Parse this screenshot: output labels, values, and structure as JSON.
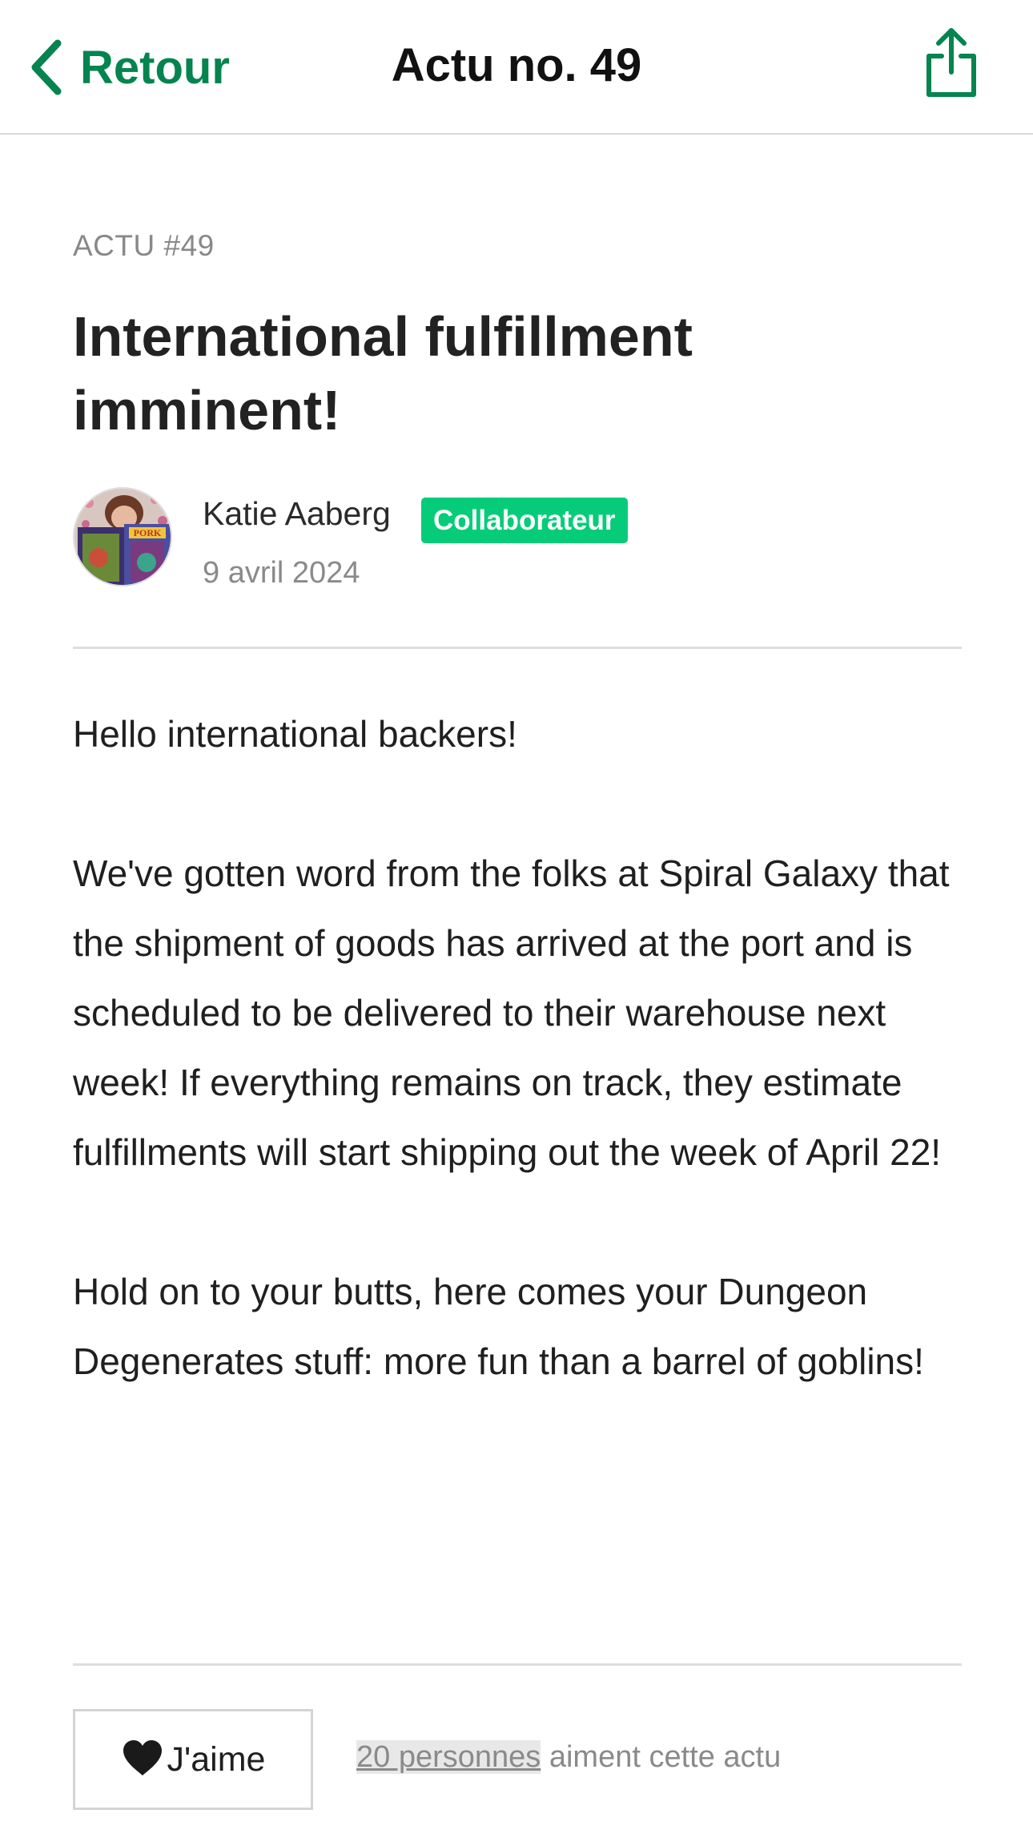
{
  "nav": {
    "back_label": "Retour",
    "title": "Actu no. 49",
    "back_icon": "chevron-left-icon",
    "share_icon": "share-icon"
  },
  "post": {
    "kicker": "ACTU #49",
    "title": "International fulfillment imminent!",
    "author": {
      "name": "Katie Aaberg",
      "role_badge": "Collaborateur",
      "avatar_icon": "avatar"
    },
    "date": "9 avril 2024",
    "paragraphs": [
      "Hello international backers!",
      "We've gotten word from the folks at Spiral Galaxy that the shipment of goods has arrived at the port and is scheduled to be delivered to their warehouse next week! If everything remains on track, they estimate fulfillments will start shipping out the week of April 22!",
      "Hold on to your butts, here comes your Dungeon Degenerates stuff: more fun than a barrel of goblins!"
    ]
  },
  "footer": {
    "like_label": "J'aime",
    "like_icon": "heart-icon",
    "likes_link": "20 personnes",
    "likes_suffix": " aiment cette actu"
  },
  "colors": {
    "accent": "#05844f",
    "badge": "#06cc79"
  }
}
